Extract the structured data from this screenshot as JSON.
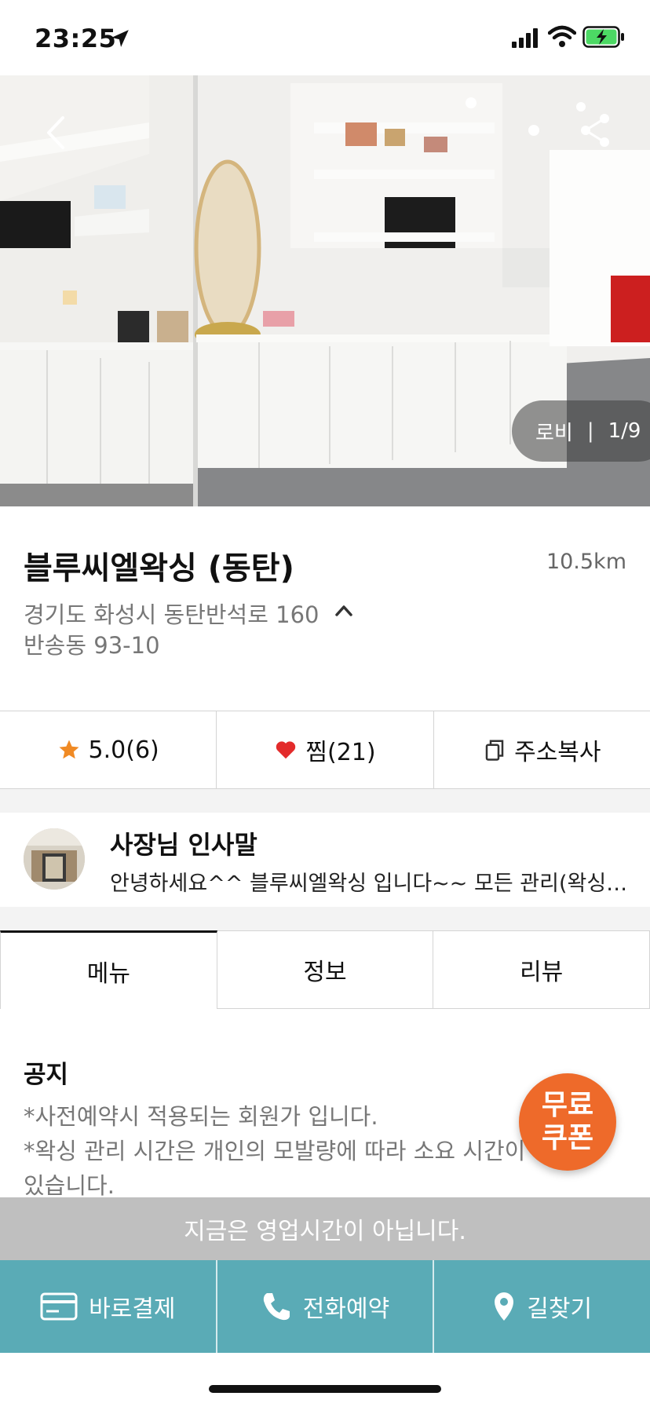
{
  "status_bar": {
    "time": "23:25"
  },
  "hero": {
    "photo_label": "로비",
    "photo_separator": "|",
    "photo_counter": "1/9"
  },
  "shop": {
    "name": "블루씨엘왁싱 (동탄)",
    "distance": "10.5km",
    "address_road": "경기도 화성시 동탄반석로 160",
    "address_lot": "반송동 93-10"
  },
  "actions": {
    "rating": "5.0(6)",
    "favorite": "찜(21)",
    "copy_address": "주소복사"
  },
  "greeting": {
    "title": "사장님 인사말",
    "text": "안녕하세요^^  블루씨엘왁싱 입니다~~  모든 관리(왁싱)는 회원가 적용됩니다"
  },
  "tabs": [
    {
      "label": "메뉴"
    },
    {
      "label": "정보"
    },
    {
      "label": "리뷰"
    }
  ],
  "notice": {
    "title": "공지",
    "lines": [
      "*사전예약시 적용되는 회원가 입니다.",
      "*왁싱 관리 시간은 개인의 모발량에 따라 소요 시간이 다를 수",
      "있습니다."
    ]
  },
  "coupon": {
    "line1": "무료",
    "line2": "쿠폰"
  },
  "closed_banner": "지금은 영업시간이 아닙니다.",
  "bottom_bar": {
    "pay": "바로결제",
    "call": "전화예약",
    "directions": "길찾기"
  },
  "colors": {
    "accent": "#5aabb6",
    "coupon": "#ee6a2a",
    "star": "#f08a24",
    "heart": "#e32b2b",
    "banner": "#bfbfbf"
  }
}
